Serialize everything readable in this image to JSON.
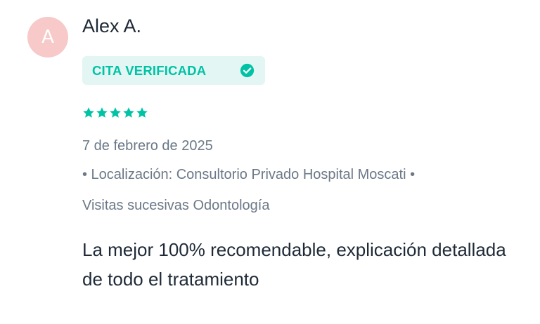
{
  "review": {
    "avatar_initial": "A",
    "author_name": "Alex A.",
    "badge_label": "CITA VERIFICADA",
    "badge_icon": "check-circle-icon",
    "rating": 5,
    "rating_max": 5,
    "date": "7 de febrero de 2025",
    "location": "• Localización: Consultorio Privado Hospital Moscati •",
    "visit_type": "Visitas sucesivas Odontología",
    "comment": "La mejor 100% recomendable, explicación detallada de todo el tratamiento"
  },
  "colors": {
    "accent": "#00c3a5",
    "badge_background": "#e3f6f3",
    "avatar_background": "#f7c9c9",
    "text_primary": "#1f2a37",
    "text_secondary": "#6b7887"
  }
}
